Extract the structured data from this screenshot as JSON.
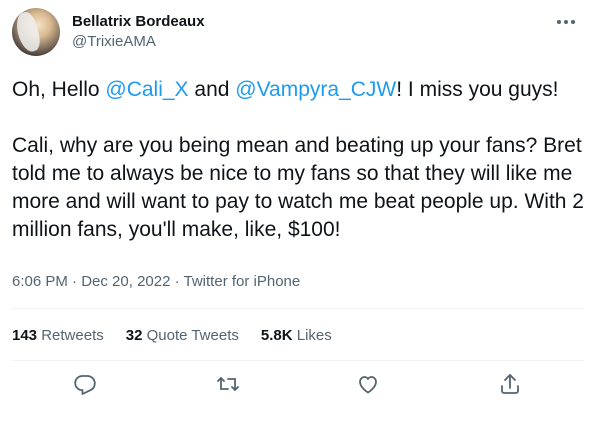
{
  "author": {
    "display_name": "Bellatrix Bordeaux",
    "handle": "@TrixieAMA"
  },
  "tweet": {
    "line1_pre": "Oh, Hello ",
    "mention1": "@Cali_X",
    "line1_mid": " and ",
    "mention2": "@Vampyra_CJW",
    "line1_post": "! I miss you guys!",
    "paragraph2": "Cali, why are you being mean and beating up your fans? Bret told me to always be nice to my fans so that they will like me more and will want to pay to watch me beat people up. With 2 million fans, you'll make, like, $100!"
  },
  "meta": {
    "time": "6:06 PM",
    "separator1": " · ",
    "date": "Dec 20, 2022",
    "separator2": " · ",
    "source": "Twitter for iPhone"
  },
  "stats": {
    "retweets_count": "143",
    "retweets_label": "Retweets",
    "quotes_count": "32",
    "quotes_label": "Quote Tweets",
    "likes_count": "5.8K",
    "likes_label": "Likes"
  },
  "icons": {
    "more": "more-horizontal-icon",
    "reply": "reply-icon",
    "retweet": "retweet-icon",
    "like": "heart-icon",
    "share": "share-icon"
  },
  "colors": {
    "text": "#0f1419",
    "secondary": "#536471",
    "link": "#1d9bf0",
    "divider": "#eff3f4"
  }
}
